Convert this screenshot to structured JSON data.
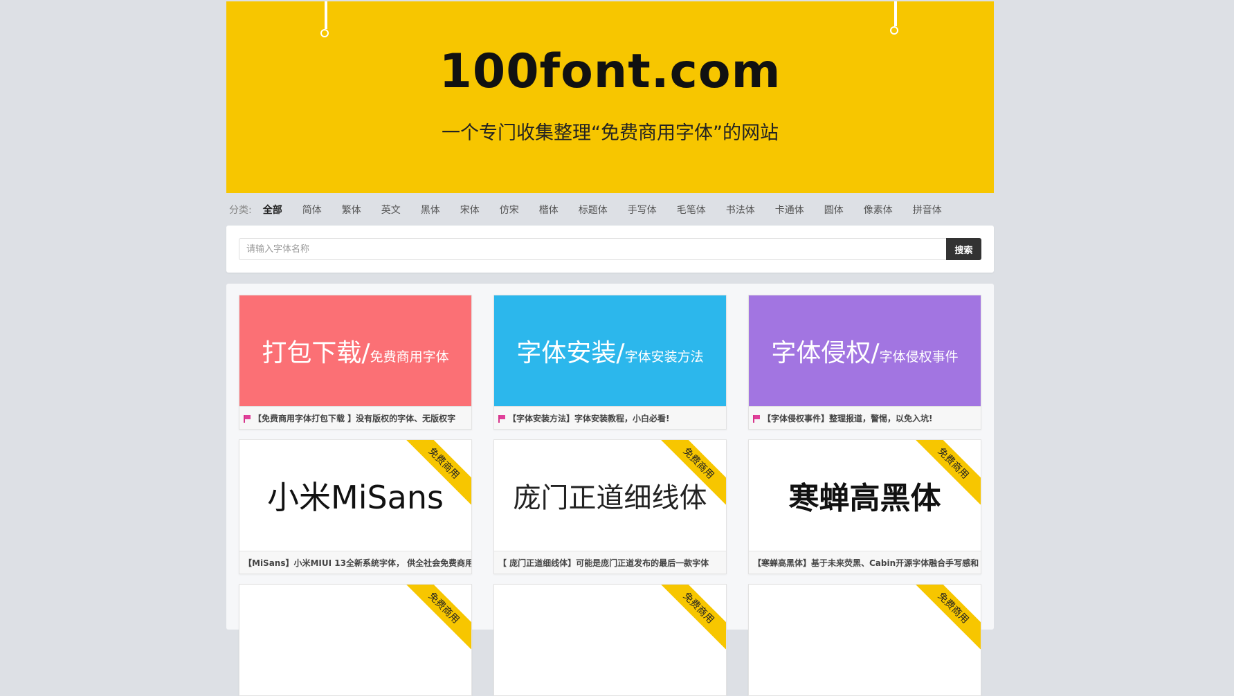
{
  "banner": {
    "title": "100font.com",
    "subtitle": "一个专门收集整理“免费商用字体”的网站"
  },
  "categories": {
    "label": "分类:",
    "items": [
      "全部",
      "简体",
      "繁体",
      "英文",
      "黑体",
      "宋体",
      "仿宋",
      "楷体",
      "标题体",
      "手写体",
      "毛笔体",
      "书法体",
      "卡通体",
      "圆体",
      "像素体",
      "拼音体"
    ]
  },
  "search": {
    "placeholder": "请输入字体名称",
    "button": "搜索"
  },
  "featured": [
    {
      "big": "打包下载/",
      "small": "免费商用字体",
      "caption": "【免费商用字体打包下载 】没有版权的字体、无版权字",
      "color": "#fb7075"
    },
    {
      "big": "字体安装/",
      "small": "字体安装方法",
      "caption": "【字体安装方法】字体安装教程，小白必看!",
      "color": "#2cb7ec"
    },
    {
      "big": "字体侵权/",
      "small": "字体侵权事件",
      "caption": "【字体侵权事件】整理报道，警惕，以免入坑!",
      "color": "#a275e1"
    }
  ],
  "fonts": [
    {
      "sample": "小米MiSans",
      "ribbon": "免费商用",
      "caption": "【MiSans】小米MIUI 13全新系统字体， 供全社会免费商用"
    },
    {
      "sample": "庞门正道细线体",
      "ribbon": "免费商用",
      "caption": "【 庞门正道细线体】可能是庞门正道发布的最后一款字体"
    },
    {
      "sample": "寒蝉高黑体",
      "ribbon": "免费商用",
      "caption": "【寒蝉高黑体】基于未来荧黑、Cabin开源字体融合手写感和"
    }
  ],
  "partial_ribbons": [
    "免费商用",
    "免费商用",
    "免费商用"
  ]
}
